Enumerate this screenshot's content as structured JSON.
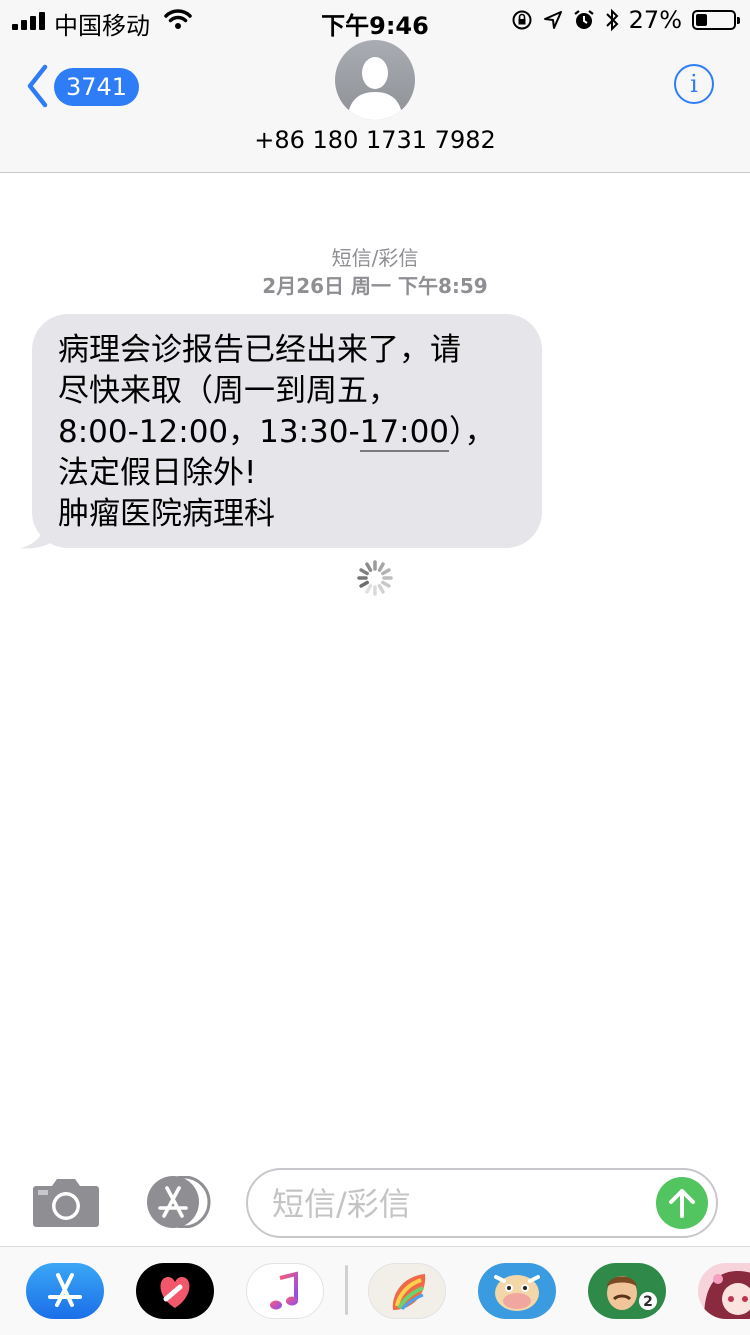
{
  "status_bar": {
    "carrier": "中国移动",
    "time": "下午9:46",
    "battery_percent": "27%",
    "battery_level": 0.27,
    "icons": [
      "signal-icon",
      "wifi-icon",
      "orientation-lock-icon",
      "location-icon",
      "alarm-icon",
      "bluetooth-icon",
      "battery-icon"
    ]
  },
  "header": {
    "back_count": "3741",
    "contact_number": "+86 180 1731 7982",
    "info_label": "i"
  },
  "conversation": {
    "message_type": "短信/彩信",
    "timestamp": "2月26日 周一 下午8:59",
    "message": {
      "line1": "病理会诊报告已经出来了，请",
      "line2": "尽快来取（周一到周五，",
      "line3a": "8:00-12:00，13:30-",
      "line3b": "17:00",
      "line3c": "），",
      "line4": "法定假日除外!",
      "line5": "肿瘤医院病理科"
    }
  },
  "input_bar": {
    "placeholder": "短信/彩信"
  },
  "app_drawer": {
    "apps": [
      "app-store-icon",
      "digital-touch-icon",
      "music-icon",
      "rainbow-leaf-app-icon",
      "cow-game-icon",
      "homescapes-game-icon",
      "anime-app-icon"
    ]
  },
  "colors": {
    "accent_blue": "#2f7df6",
    "bubble_gray": "#e5e5ea",
    "send_green": "#52c460",
    "meta_gray": "#8e8e93"
  }
}
